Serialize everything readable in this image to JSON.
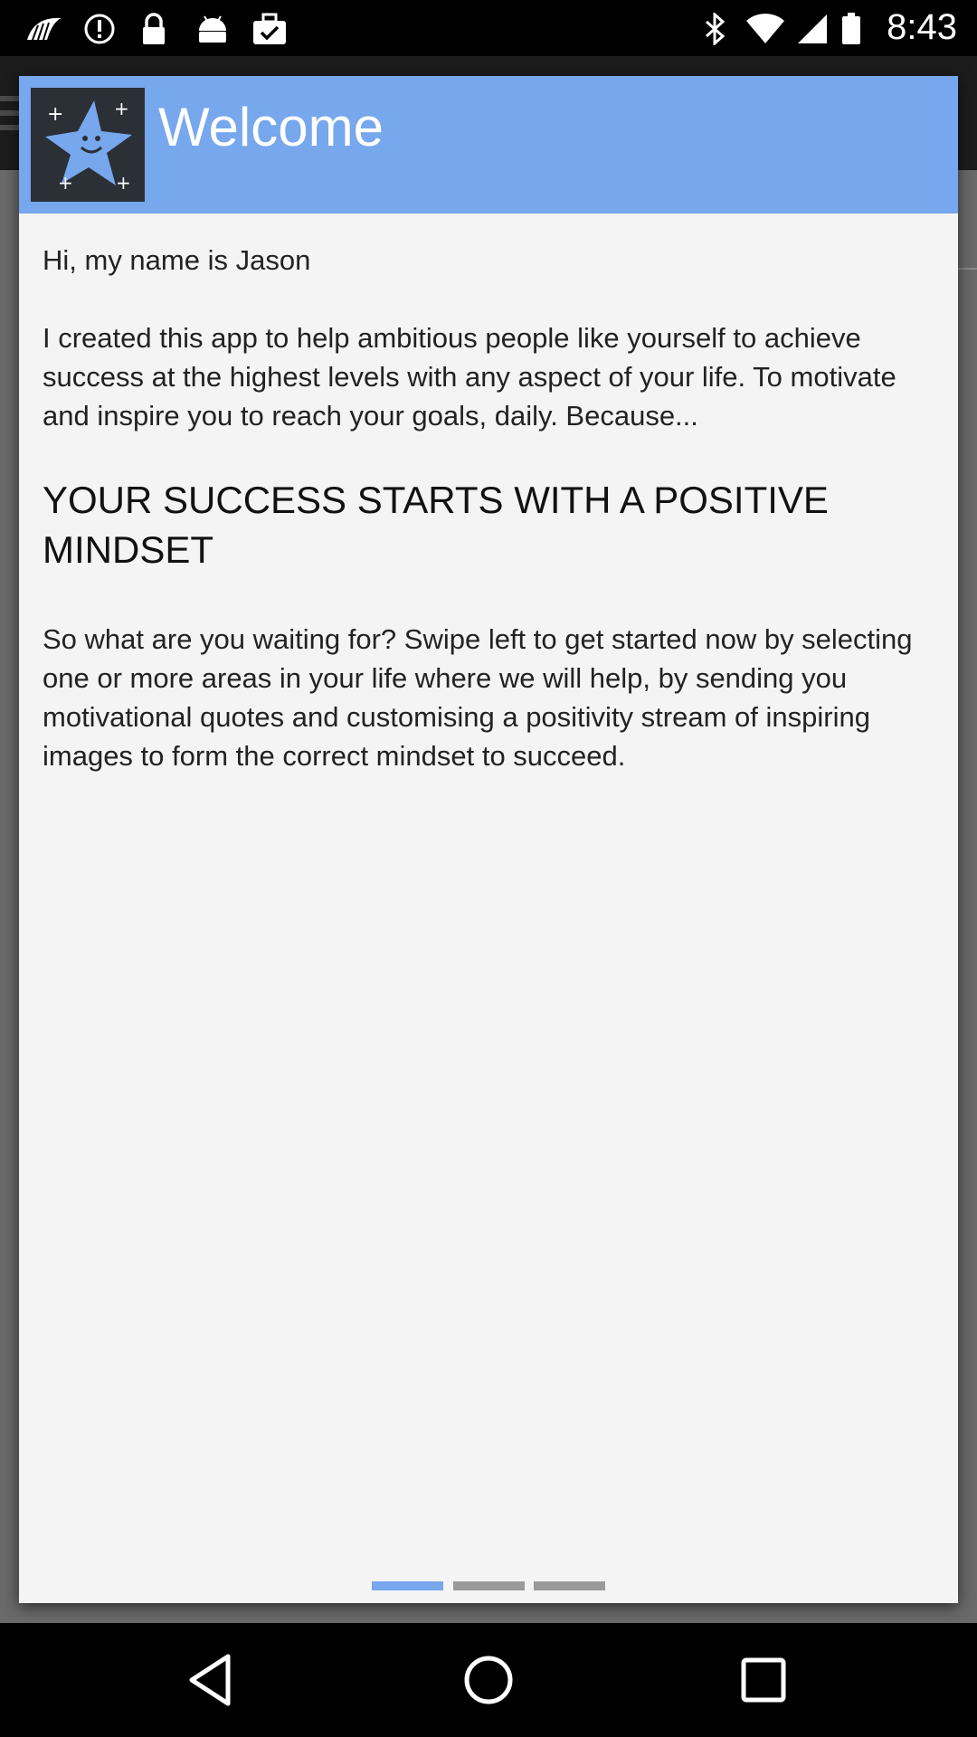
{
  "status_bar": {
    "time": "8:43",
    "icons": [
      "fan-icon",
      "alert-circle-icon",
      "lock-icon",
      "android-icon",
      "briefcase-check-icon",
      "bluetooth-icon",
      "wifi-icon",
      "signal-icon",
      "battery-icon"
    ]
  },
  "dialog": {
    "title": "Welcome",
    "logo_icon": "smiling-star-logo",
    "greeting": "Hi, my name is Jason",
    "intro": "I created this app to help ambitious people like yourself to achieve success at the highest levels with any aspect of your life. To motivate and inspire you to reach your goals, daily. Because...",
    "headline": "YOUR SUCCESS STARTS WITH A POSITIVE MINDSET",
    "call_to_action": "So what are you waiting for? Swipe left to get started now by selecting one or more areas in your life where we will help, by sending you motivational quotes and customising a positivity stream of inspiring images to form the correct mindset to succeed.",
    "pager": {
      "total": 3,
      "active_index": 0
    }
  },
  "colors": {
    "header": "#77a7ec",
    "dialog_bg": "#f4f4f4",
    "pager_active": "#77a7ec",
    "pager_inactive": "#9a9a9a"
  },
  "nav_bar": {
    "buttons": [
      "back-icon",
      "home-icon",
      "recents-icon"
    ]
  }
}
